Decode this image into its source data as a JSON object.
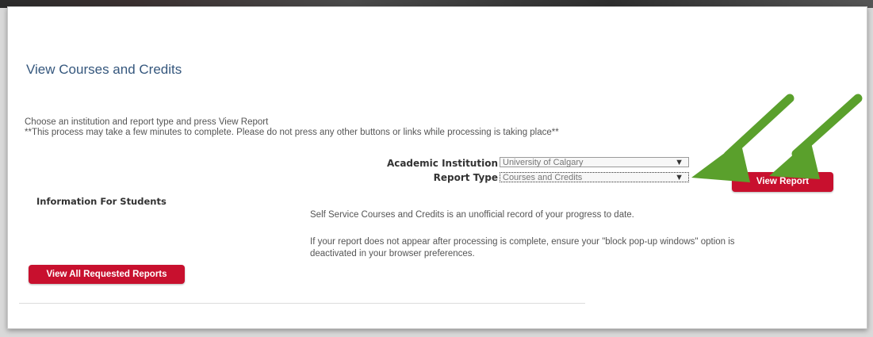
{
  "dialog": {
    "title": "View Courses and Credits",
    "instruction_line1": "Choose an institution and report type and press View Report",
    "instruction_line2": "**This process may take a few minutes to complete. Please do not press any other buttons or links while processing is taking place**"
  },
  "form": {
    "institution_label": "Academic Institution",
    "institution_value": "University of Calgary",
    "report_type_label": "Report Type",
    "report_type_value": "Courses and Credits",
    "dropdown_arrow": "▼",
    "view_report_label": "View Report"
  },
  "info": {
    "title": "Information For Students",
    "paragraph1": "Self Service Courses and Credits is an unofficial record of your progress to date.",
    "paragraph2": "If your report does not appear after processing is complete, ensure your \"block pop-up windows\" option is deactivated in your browser preferences.",
    "view_all_label": "View All Requested Reports"
  },
  "colors": {
    "accent": "#c8102e",
    "title": "#35577d",
    "annotation_arrow": "#5aa02c"
  }
}
